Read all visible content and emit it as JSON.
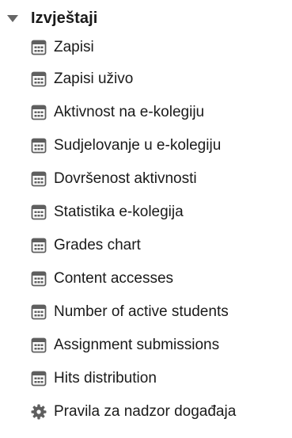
{
  "reports": {
    "title": "Izvještaji",
    "items": [
      {
        "label": "Zapisi",
        "icon": "report-icon"
      },
      {
        "label": "Zapisi uživo",
        "icon": "report-icon"
      },
      {
        "label": "Aktivnost na e-kolegiju",
        "icon": "report-icon"
      },
      {
        "label": "Sudjelovanje u e-kolegiju",
        "icon": "report-icon"
      },
      {
        "label": "Dovršenost aktivnosti",
        "icon": "report-icon"
      },
      {
        "label": "Statistika e-kolegija",
        "icon": "report-icon"
      },
      {
        "label": "Grades chart",
        "icon": "report-icon"
      },
      {
        "label": "Content accesses",
        "icon": "report-icon"
      },
      {
        "label": "Number of active students",
        "icon": "report-icon"
      },
      {
        "label": "Assignment submissions",
        "icon": "report-icon"
      },
      {
        "label": "Hits distribution",
        "icon": "report-icon"
      },
      {
        "label": "Pravila za nadzor događaja",
        "icon": "gear-icon"
      }
    ]
  },
  "colors": {
    "text": "#1a1a1a",
    "caret": "#666666",
    "icon": "#666666"
  }
}
